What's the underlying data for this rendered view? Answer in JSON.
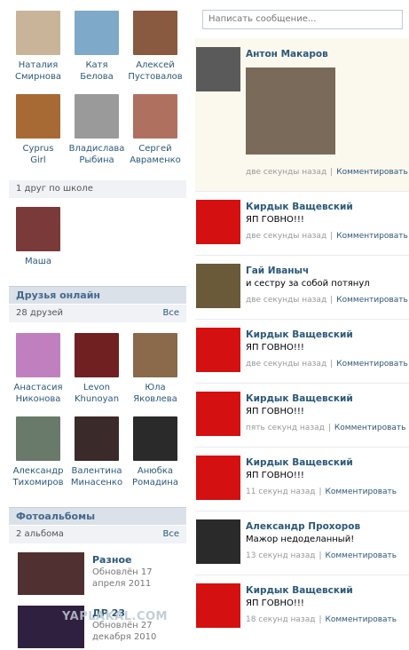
{
  "friends_top": [
    {
      "first": "Наталия",
      "last": "Смирнова",
      "color": "#c9b49a"
    },
    {
      "first": "Катя",
      "last": "Белова",
      "color": "#7fa9c9"
    },
    {
      "first": "Алексей",
      "last": "Пустовалов",
      "color": "#8a5a40"
    },
    {
      "first": "Cyprus",
      "last": "Girl",
      "color": "#a86a34"
    },
    {
      "first": "Владислава",
      "last": "Рыбина",
      "color": "#9a9a9a"
    },
    {
      "first": "Сергей",
      "last": "Авраменко",
      "color": "#b07060"
    }
  ],
  "school": {
    "header": "1 друг по школе",
    "friend": {
      "first": "Маша",
      "color": "#7a3a3a"
    }
  },
  "online": {
    "title": "Друзья онлайн",
    "count": "28 друзей",
    "all": "Все",
    "friends": [
      {
        "first": "Анастасия",
        "last": "Никонова",
        "color": "#c080c0"
      },
      {
        "first": "Levon",
        "last": "Khunoyan",
        "color": "#702020"
      },
      {
        "first": "Юла",
        "last": "Яковлева",
        "color": "#8a6a4a"
      },
      {
        "first": "Александр",
        "last": "Тихомиров",
        "color": "#6a7a6a"
      },
      {
        "first": "Валентина",
        "last": "Минасенко",
        "color": "#3a2a2a"
      },
      {
        "first": "Анюбка",
        "last": "Ромадина",
        "color": "#2a2a2a"
      }
    ]
  },
  "albums": {
    "title": "Фотоальбомы",
    "count": "2 альбома",
    "all": "Все",
    "items": [
      {
        "title": "Разное",
        "updated": "Обновлён 17 апреля 2011",
        "color": "#503030"
      },
      {
        "title": "ДР 23",
        "updated": "Обновлён 27 декабря 2010",
        "color": "#302040"
      }
    ]
  },
  "wall": {
    "placeholder": "Написать сообщение...",
    "comment_label": "Комментировать",
    "posts": [
      {
        "author": "Антон Макаров",
        "text": "",
        "time": "две секунды назад",
        "color": "#5a5a5a",
        "has_photo": true
      },
      {
        "author": "Кирдык Ващевский",
        "text": "ЯП ГОВНО!!!",
        "time": "две секунды назад",
        "color": "#d41010"
      },
      {
        "author": "Гай Иваныч",
        "text": "и сестру за собой потянул",
        "time": "две секунды назад",
        "color": "#6a5a3a"
      },
      {
        "author": "Кирдык Ващевский",
        "text": "ЯП ГОВНО!!!",
        "time": "две секунды назад",
        "color": "#d41010"
      },
      {
        "author": "Кирдык Ващевский",
        "text": "ЯП ГОВНО!!!",
        "time": "пять секунд назад",
        "color": "#d41010"
      },
      {
        "author": "Кирдык Ващевский",
        "text": "ЯП ГОВНО!!!",
        "time": "11 секунд назад",
        "color": "#d41010"
      },
      {
        "author": "Александр Прохоров",
        "text": "Мажор недоделанный!",
        "time": "13 секунд назад",
        "color": "#2a2a2a"
      },
      {
        "author": "Кирдык Ващевский",
        "text": "ЯП ГОВНО!!!",
        "time": "18 секунд назад",
        "color": "#d41010"
      }
    ]
  },
  "watermark": "YAPLAKAL.COM"
}
